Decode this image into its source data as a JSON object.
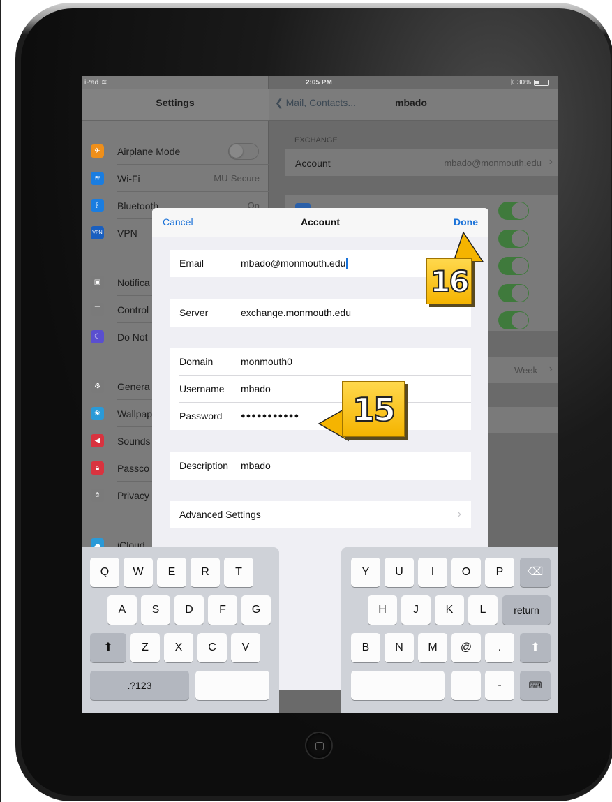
{
  "status_bar": {
    "device": "iPad",
    "time": "2:05 PM",
    "battery": "30%"
  },
  "sidebar": {
    "title": "Settings",
    "items": [
      {
        "label": "Airplane Mode",
        "value": "",
        "icon": "airplane-icon",
        "color": "#ef8f1a"
      },
      {
        "label": "Wi-Fi",
        "value": "MU-Secure",
        "icon": "wifi-icon",
        "color": "#1a7de0"
      },
      {
        "label": "Bluetooth",
        "value": "On",
        "icon": "bluetooth-icon",
        "color": "#1a7de0"
      },
      {
        "label": "VPN",
        "value": "",
        "icon": "vpn-icon",
        "color": "#1a5fbf"
      },
      {
        "label": "Notifica",
        "value": "",
        "icon": "notifications-icon",
        "color": "#7a7a7a"
      },
      {
        "label": "Control",
        "value": "",
        "icon": "control-center-icon",
        "color": "#7a7a7a"
      },
      {
        "label": "Do Not",
        "value": "",
        "icon": "moon-icon",
        "color": "#5a4fcf"
      },
      {
        "label": "Genera",
        "value": "",
        "icon": "gear-icon",
        "color": "#7a7a7a"
      },
      {
        "label": "Wallpap",
        "value": "",
        "icon": "wallpaper-icon",
        "color": "#2a9ad8"
      },
      {
        "label": "Sounds",
        "value": "",
        "icon": "sound-icon",
        "color": "#d9333f"
      },
      {
        "label": "Passco",
        "value": "",
        "icon": "lock-icon",
        "color": "#d9333f"
      },
      {
        "label": "Privacy",
        "value": "",
        "icon": "hand-icon",
        "color": "#7a7a7a"
      },
      {
        "label": "iCloud",
        "value": "",
        "icon": "cloud-icon",
        "color": "#2a9ad8"
      }
    ]
  },
  "detail": {
    "back_label": "Mail, Contacts...",
    "title": "mbado",
    "section_caption": "EXCHANGE",
    "account_label": "Account",
    "account_value": "mbado@monmouth.edu",
    "mail_days": "Week"
  },
  "modal": {
    "cancel_label": "Cancel",
    "title": "Account",
    "done_label": "Done",
    "email_label": "Email",
    "email_value": "mbado@monmouth.edu",
    "server_label": "Server",
    "server_value": "exchange.monmouth.edu",
    "domain_label": "Domain",
    "domain_value": "monmouth0",
    "username_label": "Username",
    "username_value": "mbado",
    "password_label": "Password",
    "password_value": "●●●●●●●●●●●",
    "description_label": "Description",
    "description_value": "mbado",
    "advanced_label": "Advanced Settings"
  },
  "keyboard": {
    "left_rows": [
      [
        "Q",
        "W",
        "E",
        "R",
        "T"
      ],
      [
        "A",
        "S",
        "D",
        "F",
        "G"
      ],
      [
        "Z",
        "X",
        "C",
        "V"
      ]
    ],
    "right_rows": [
      [
        "Y",
        "U",
        "I",
        "O",
        "P"
      ],
      [
        "H",
        "J",
        "K",
        "L"
      ],
      [
        "B",
        "N",
        "M",
        "@",
        "."
      ]
    ],
    "return_label": "return",
    "numbers_label": ".?123",
    "underscore_label": "_",
    "dash_label": "-"
  },
  "callouts": {
    "step_15": "15",
    "step_16": "16"
  }
}
